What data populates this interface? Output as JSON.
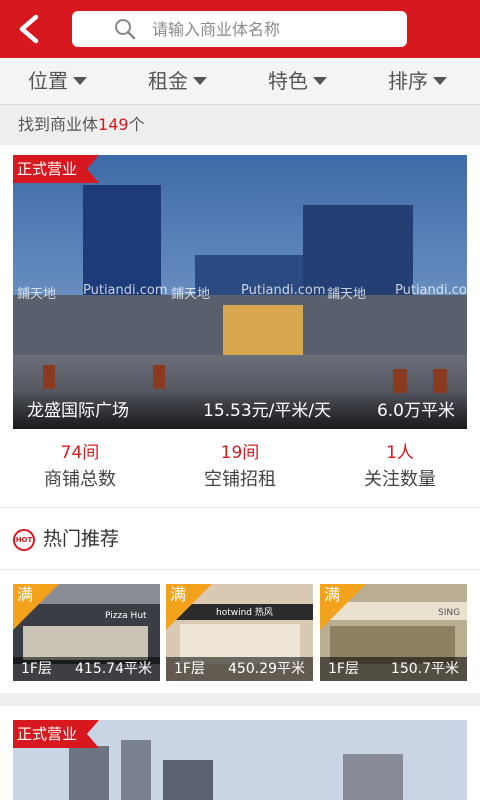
{
  "header": {
    "back_icon": "back-arrow-icon",
    "search_placeholder": "请输入商业体名称",
    "search_icon": "search-icon",
    "accent_color": "#d7191f"
  },
  "filters": [
    {
      "label": "位置"
    },
    {
      "label": "租金"
    },
    {
      "label": "特色"
    },
    {
      "label": "排序"
    }
  ],
  "results": {
    "prefix": "找到商业体",
    "count": "149",
    "suffix": "个"
  },
  "listing": {
    "status": "正式营业",
    "name": "龙盛国际广场",
    "price": "15.53元/平米/天",
    "area": "6.0万平米",
    "watermark_1": "鋪天地",
    "watermark_2": "Putiandi.com",
    "watermark_3": "鋪天地",
    "watermark_4": "Putiandi.com",
    "watermark_5": "鋪天地",
    "watermark_6": "Putiandi.com",
    "stats": [
      {
        "value": "74间",
        "label": "商铺总数"
      },
      {
        "value": "19间",
        "label": "空铺招租"
      },
      {
        "value": "1人",
        "label": "关注数量"
      }
    ]
  },
  "hot": {
    "icon_text": "HOT",
    "title": "热门推荐",
    "items": [
      {
        "tag": "满",
        "floor": "1F层",
        "area": "415.74平米",
        "sign": "Pizza Hut"
      },
      {
        "tag": "满",
        "floor": "1F层",
        "area": "450.29平米",
        "sign": "hotwind 热风"
      },
      {
        "tag": "满",
        "floor": "1F层",
        "area": "150.7平米",
        "sign": "SING"
      }
    ]
  },
  "listing2": {
    "status": "正式营业"
  }
}
